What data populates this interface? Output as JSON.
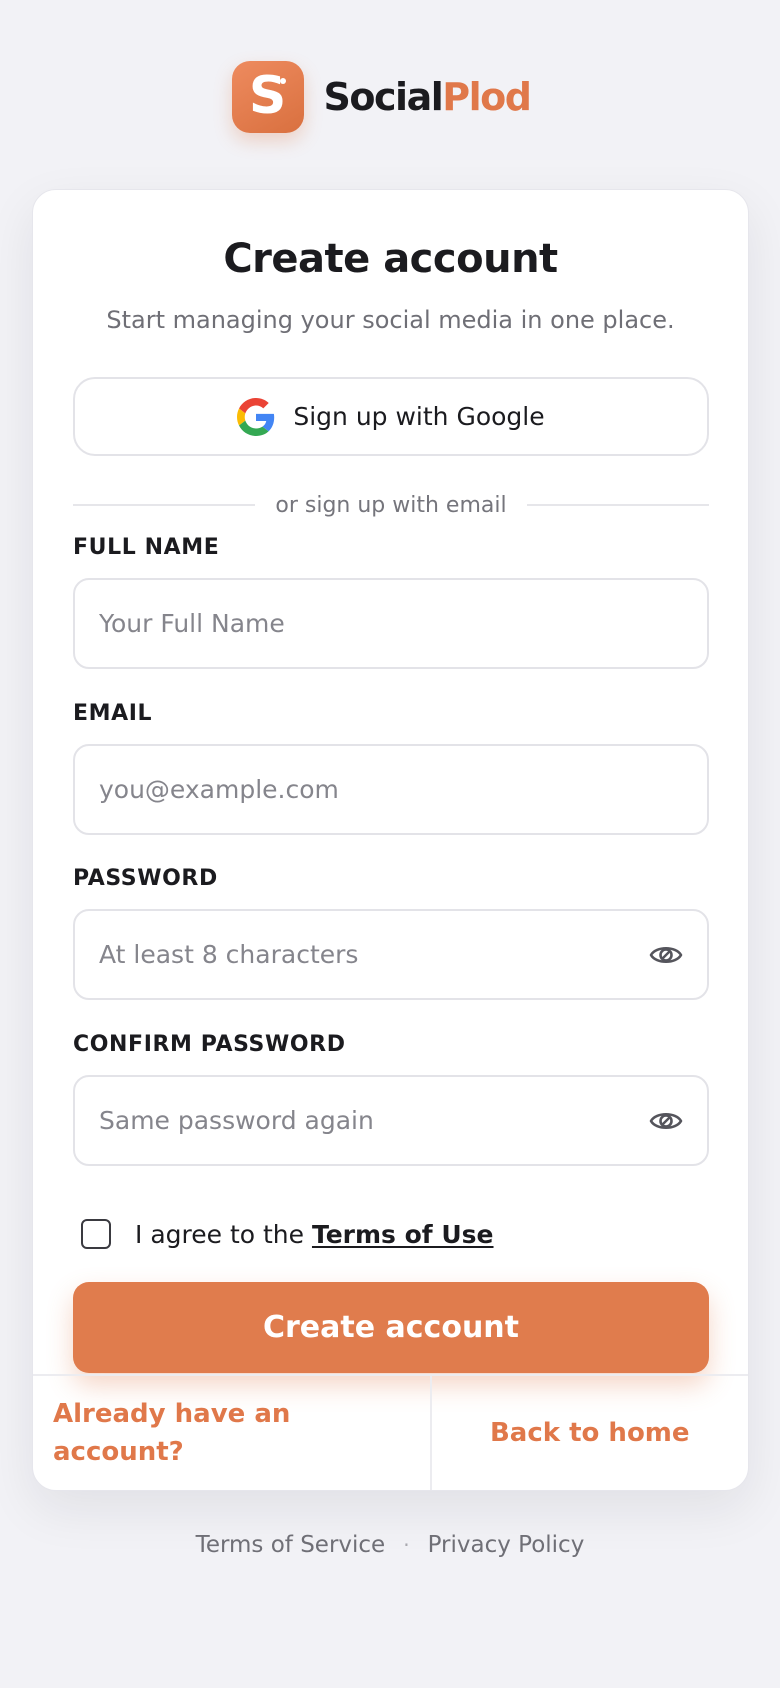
{
  "brand": {
    "logo_letter": "S",
    "name_part1": "Social",
    "name_part2": "Plod",
    "accent_color": "#e07c4d"
  },
  "header": {
    "title": "Create account",
    "subtitle": "Start managing your social media in one place."
  },
  "google": {
    "label": "Sign up with Google",
    "icon": "google-icon"
  },
  "divider": {
    "text": "or sign up with email"
  },
  "fields": {
    "full_name": {
      "label": "FULL NAME",
      "placeholder": "Your Full Name",
      "value": ""
    },
    "email": {
      "label": "EMAIL",
      "placeholder": "you@example.com",
      "value": ""
    },
    "password": {
      "label": "PASSWORD",
      "placeholder": "At least 8 characters",
      "value": "",
      "icon": "eye-icon"
    },
    "confirm_password": {
      "label": "CONFIRM PASSWORD",
      "placeholder": "Same password again",
      "value": "",
      "icon": "eye-icon"
    }
  },
  "agree": {
    "prefix": "I agree to the ",
    "link": "Terms of Use",
    "checked": false
  },
  "submit": {
    "label": "Create account"
  },
  "footer": {
    "login_link": "Already have an account?",
    "home_link": "Back to home"
  },
  "legal": {
    "terms": "Terms of Service",
    "separator": "·",
    "privacy": "Privacy Policy"
  }
}
